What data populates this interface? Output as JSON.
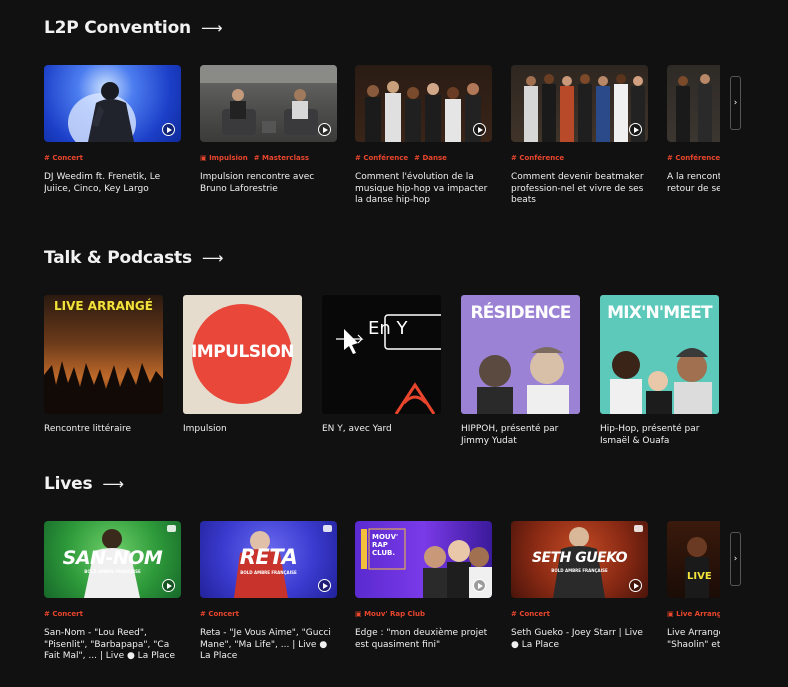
{
  "sections": {
    "convention": {
      "title": "L2P Convention",
      "arrow": "⟶",
      "cards": [
        {
          "tags": [
            "Concert"
          ],
          "title": "DJ Weedim ft. Frenetik, Le Juiice, Cinco, Key Largo"
        },
        {
          "tags": [
            "Impulsion",
            "Masterclass"
          ],
          "title": "Impulsion rencontre avec Bruno Laforestrie"
        },
        {
          "tags": [
            "Conférence",
            "Danse"
          ],
          "title": "Comment l'évolution de la musique hip-hop va impacter la danse hip-hop"
        },
        {
          "tags": [
            "Conférence"
          ],
          "title": "Comment devenir beatmaker profession-nel et vivre de ses beats"
        },
        {
          "tags": [
            "Conférence"
          ],
          "title": "A la rencontre des hitmakers : retour de session d'écriture"
        }
      ]
    },
    "talk": {
      "title": "Talk & Podcasts",
      "arrow": "⟶",
      "cards": [
        {
          "title": "Rencontre littéraire",
          "cover_text": "LIVE ARRANGÉ"
        },
        {
          "title": "Impulsion",
          "cover_text": "IMPULSION"
        },
        {
          "title": "EN Y, avec Yard",
          "cover_text": "En Y"
        },
        {
          "title": "HIPPOH, présenté par Jimmy Yudat",
          "cover_text": "RÉSIDENCE"
        },
        {
          "title": "Hip-Hop, présenté par Ismaël & Ouafa",
          "cover_text": "MIX'N'MEET"
        }
      ]
    },
    "lives": {
      "title": "Lives",
      "arrow": "⟶",
      "cards": [
        {
          "tags": [
            "Concert"
          ],
          "title": "San-Nom - \"Lou Reed\", \"Pisenlit\", \"Barbapapa\", \"Ca Fait Mal\", ... | Live ● La Place",
          "cover_text": "SAN-NOM",
          "cover_sub": "BOLD AMBRE FRANÇAISE"
        },
        {
          "tags": [
            "Concert"
          ],
          "title": "Reta - \"Je Vous Aime\", \"Gucci Mane\", \"Ma Life\", ... | Live ● La Place",
          "cover_text": "RETA",
          "cover_sub": "BOLD AMBRE FRANÇAISE"
        },
        {
          "tags": [
            "Mouv' Rap Club"
          ],
          "title": "Edge : \"mon deuxième projet est quasiment fini\"",
          "cover_text": "MOUV' RAP CLUB."
        },
        {
          "tags": [
            "Concert"
          ],
          "title": "Seth Gueko - Joey Starr | Live ● La Place",
          "cover_text": "SETH GUEKO",
          "cover_sub": "BOLD AMBRE FRANÇAISE"
        },
        {
          "tags": [
            "Live Arrangé"
          ],
          "title": "Live Arrangé : Jok'air revisite \"Shaolin\" et \"Sipa\"",
          "cover_text": "LIVE"
        }
      ]
    }
  },
  "next_glyph": "›"
}
